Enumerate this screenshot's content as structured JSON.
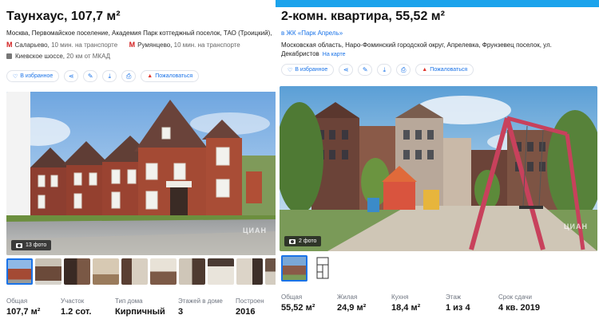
{
  "colors": {
    "accent": "#1a73e8",
    "metro": "#d21e1e",
    "banner": "#1ba3ec",
    "report": "#e0362c"
  },
  "left": {
    "title": "Таунхаус, 107,7 м²",
    "address": "Москва, Первомайское поселение, Академия Парк коттеджный поселок, ТАО (Троицкий),",
    "metro": [
      {
        "station": "Саларьево",
        "time": "10 мин. на транспорте"
      },
      {
        "station": "Румянцево",
        "time": "10 мин. на транспорте"
      }
    ],
    "road": {
      "name": "Киевское шоссе,",
      "distance": "20 км от МКАД"
    },
    "actions": {
      "favorite": "В избранное",
      "report": "Пожаловаться"
    },
    "gallery": {
      "photo_count": "13 фото",
      "watermark": "ЦИАН"
    },
    "params": [
      {
        "label": "Общая",
        "value": "107,7 м²"
      },
      {
        "label": "Участок",
        "value": "1.2 сот."
      },
      {
        "label": "Тип дома",
        "value": "Кирпичный"
      },
      {
        "label": "Этажей в доме",
        "value": "3"
      },
      {
        "label": "Построен",
        "value": "2016"
      }
    ]
  },
  "right": {
    "title": "2-комн. квартира, 55,52 м²",
    "complex_link": "в ЖК «Парк Апрель»",
    "address_line1": "Московская область, Наро-Фоминский городской округ, Апрелевка, Фрунзевец поселок, ул.",
    "address_line2": "Декабристов",
    "map_link": "На карте",
    "actions": {
      "favorite": "В избранное",
      "report": "Пожаловаться"
    },
    "gallery": {
      "photo_count": "2 фото",
      "watermark": "ЦИАН"
    },
    "params": [
      {
        "label": "Общая",
        "value": "55,52 м²"
      },
      {
        "label": "Жилая",
        "value": "24,9 м²"
      },
      {
        "label": "Кухня",
        "value": "18,4 м²"
      },
      {
        "label": "Этаж",
        "value": "1 из 4"
      },
      {
        "label": "Срок сдачи",
        "value": "4 кв. 2019"
      }
    ]
  }
}
